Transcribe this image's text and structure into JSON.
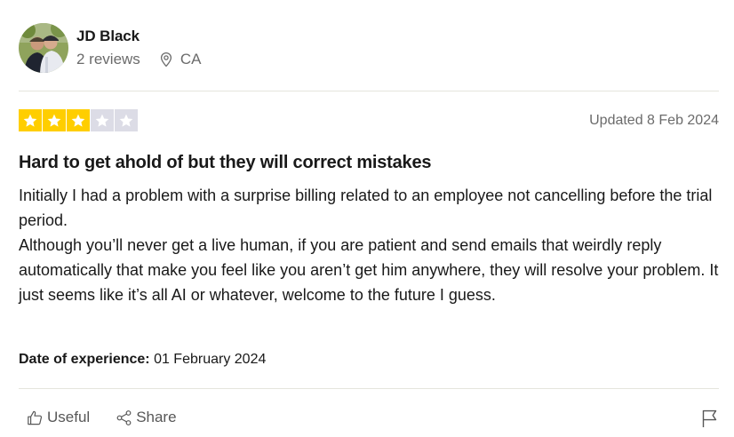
{
  "reviewer": {
    "name": "JD Black",
    "reviews_count": "2 reviews",
    "country": "CA"
  },
  "review": {
    "rating": 3,
    "max_rating": 5,
    "star_color_on": "#ffce00",
    "star_color_off": "#dcdce6",
    "updated": "Updated 8 Feb 2024",
    "title": "Hard to get ahold of but they will correct mistakes",
    "paragraphs": [
      "Initially I had a problem with a surprise billing related to an employee not cancelling before the trial period.",
      "Although you’ll never get a live human, if you are patient and send emails that weirdly reply automatically that make you feel like you aren’t get him anywhere, they will resolve your problem. It just seems like it’s all AI or whatever, welcome to the future I guess."
    ],
    "date_of_experience_label": "Date of experience:",
    "date_of_experience_value": "01 February 2024"
  },
  "actions": {
    "useful_label": "Useful",
    "share_label": "Share"
  },
  "icons": {
    "location": "location-pin-icon",
    "useful": "thumbs-up-icon",
    "share": "share-icon",
    "report": "flag-icon",
    "star": "star-icon"
  }
}
